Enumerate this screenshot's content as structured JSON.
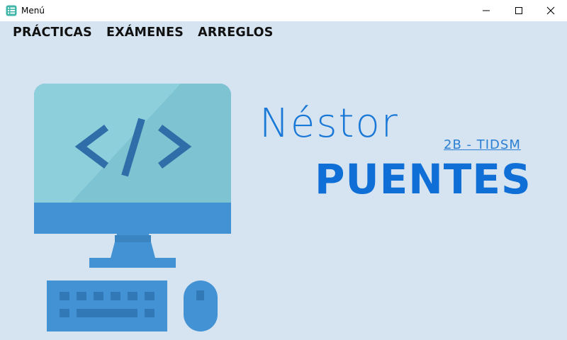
{
  "window": {
    "title": "Menú",
    "controls": {
      "minimize": "minimize-icon",
      "maximize": "maximize-icon",
      "close": "close-icon"
    }
  },
  "menu": {
    "items": [
      {
        "label": "PRÁCTICAS"
      },
      {
        "label": "EXÁMENES"
      },
      {
        "label": "ARREGLOS"
      }
    ]
  },
  "profile": {
    "first_name": "Néstor",
    "last_name": "PUENTES",
    "group_link": "2B - TIDSM"
  },
  "illustration": {
    "icon": "computer-code-icon",
    "code_symbol": "</>"
  },
  "colors": {
    "background": "#d6e4f1",
    "screen_light": "#8ecfdc",
    "screen_dark": "#7ec3d2",
    "monitor_blue": "#4393d4",
    "code_symbol": "#2f6ea8",
    "accent_text": "#1a78d6"
  }
}
